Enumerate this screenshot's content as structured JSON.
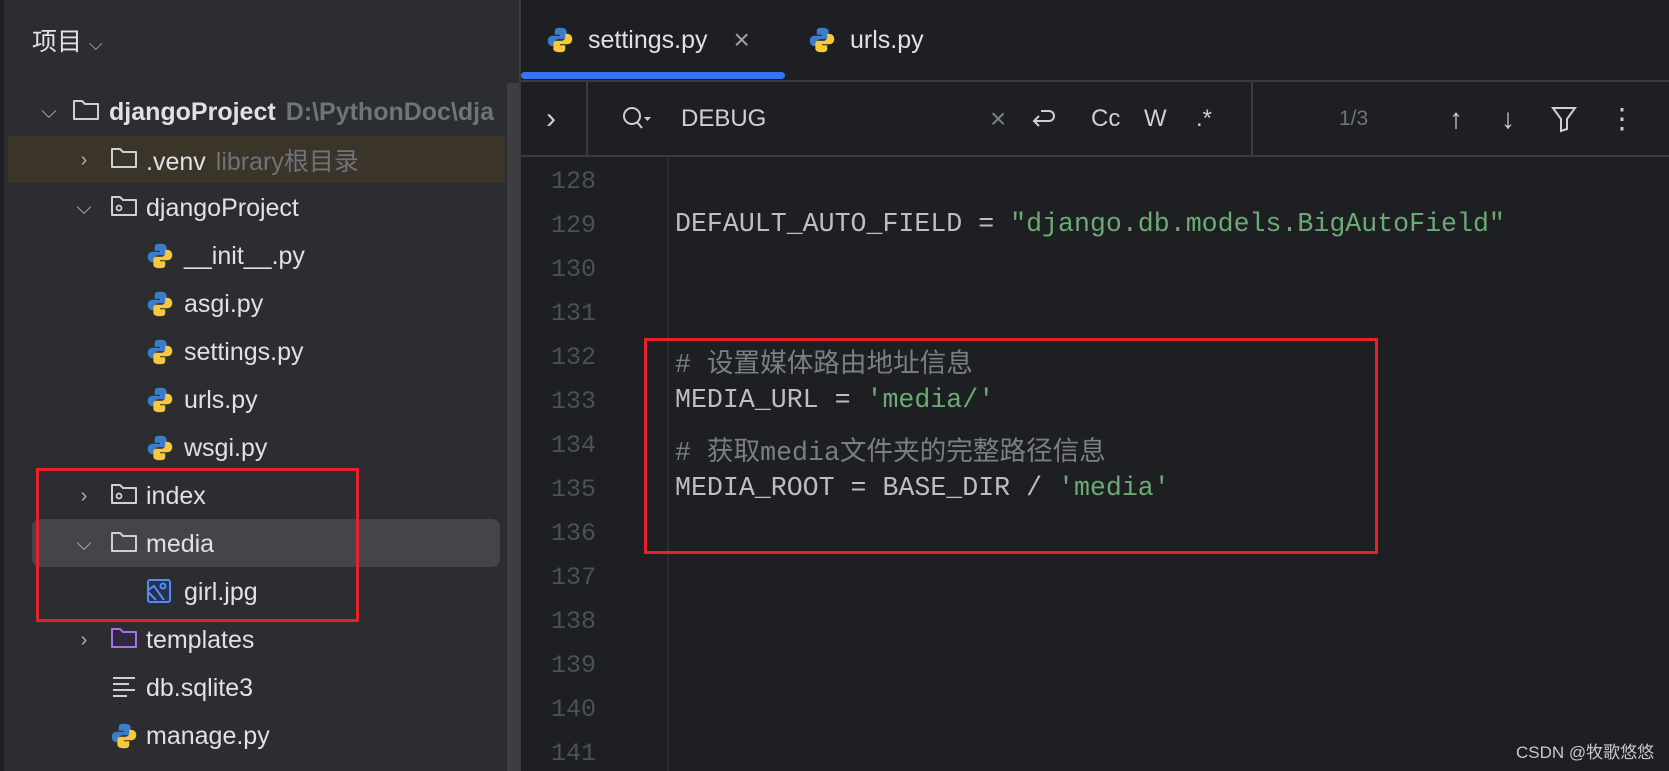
{
  "sidebar": {
    "title": "项目",
    "tree": [
      {
        "label": "djangoProject",
        "hint": "D:\\PythonDoc\\dja",
        "icon": "folder-icon",
        "expanded": true
      },
      {
        "label": ".venv",
        "hint": "library根目录",
        "icon": "folder-icon",
        "expanded": false
      },
      {
        "label": "djangoProject",
        "icon": "package-folder-icon",
        "expanded": true
      },
      {
        "label": "__init__.py",
        "icon": "python-file-icon"
      },
      {
        "label": "asgi.py",
        "icon": "python-file-icon"
      },
      {
        "label": "settings.py",
        "icon": "python-file-icon"
      },
      {
        "label": "urls.py",
        "icon": "python-file-icon"
      },
      {
        "label": "wsgi.py",
        "icon": "python-file-icon"
      },
      {
        "label": "index",
        "icon": "package-folder-icon",
        "expanded": false
      },
      {
        "label": "media",
        "icon": "folder-icon",
        "expanded": true,
        "selected": true
      },
      {
        "label": "girl.jpg",
        "icon": "image-file-icon"
      },
      {
        "label": "templates",
        "icon": "template-folder-icon",
        "expanded": false
      },
      {
        "label": "db.sqlite3",
        "icon": "text-file-icon"
      },
      {
        "label": "manage.py",
        "icon": "python-file-icon"
      }
    ]
  },
  "tabs": [
    {
      "label": "settings.py",
      "active": true,
      "close": "×"
    },
    {
      "label": "urls.py",
      "active": false
    }
  ],
  "search": {
    "expand": "›",
    "query": "DEBUG",
    "clear": "×",
    "match_case": "Cc",
    "words": "W",
    "regex": ".*",
    "count": "1/3",
    "prev": "↑",
    "next": "↓",
    "menu": "⋮"
  },
  "editor": {
    "line_numbers": [
      "128",
      "129",
      "130",
      "131",
      "132",
      "133",
      "134",
      "135",
      "136",
      "137",
      "138",
      "139",
      "140",
      "141"
    ],
    "lines": [
      {
        "parts": []
      },
      {
        "parts": [
          {
            "t": "DEFAULT_AUTO_FIELD = ",
            "c": ""
          },
          {
            "t": "\"django.db.models.BigAutoField\"",
            "c": "str"
          }
        ]
      },
      {
        "parts": []
      },
      {
        "parts": []
      },
      {
        "parts": [
          {
            "t": "# 设置媒体路由地址信息",
            "c": "cmt"
          }
        ]
      },
      {
        "parts": [
          {
            "t": "MEDIA_URL = ",
            "c": ""
          },
          {
            "t": "'media/'",
            "c": "str"
          }
        ]
      },
      {
        "parts": [
          {
            "t": "# 获取media文件夹的完整路径信息",
            "c": "cmt"
          }
        ]
      },
      {
        "parts": [
          {
            "t": "MEDIA_ROOT = BASE_DIR / ",
            "c": ""
          },
          {
            "t": "'media'",
            "c": "str"
          }
        ]
      },
      {
        "parts": []
      },
      {
        "parts": []
      },
      {
        "parts": []
      },
      {
        "parts": []
      },
      {
        "parts": []
      },
      {
        "parts": []
      }
    ]
  },
  "watermark": "CSDN @牧歌悠悠",
  "colors": {
    "accent": "#3574f0",
    "highlight": "#e8202a",
    "string": "#6aab73",
    "comment": "#7a7e85"
  }
}
